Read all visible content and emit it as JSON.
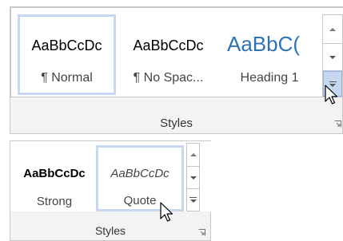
{
  "large_panel": {
    "group_label": "Styles",
    "styles": [
      {
        "sample": "AaBbCcDc",
        "name": "¶ Normal",
        "selected": true
      },
      {
        "sample": "AaBbCcDc",
        "name": "¶ No Spac...",
        "selected": false
      },
      {
        "sample": "AaBbC(",
        "name": "Heading 1",
        "selected": false
      }
    ],
    "scroll_buttons": [
      "up",
      "down",
      "more"
    ]
  },
  "small_panel": {
    "group_label": "Styles",
    "styles": [
      {
        "sample": "AaBbCcDc",
        "name": "Strong",
        "selected": false
      },
      {
        "sample": "AaBbCcDc",
        "name": "Quote",
        "selected": true
      }
    ],
    "scroll_buttons": [
      "up",
      "down",
      "more"
    ]
  },
  "colors": {
    "heading_blue": "#2e74b5",
    "selection_border": "#c5d8ef"
  }
}
